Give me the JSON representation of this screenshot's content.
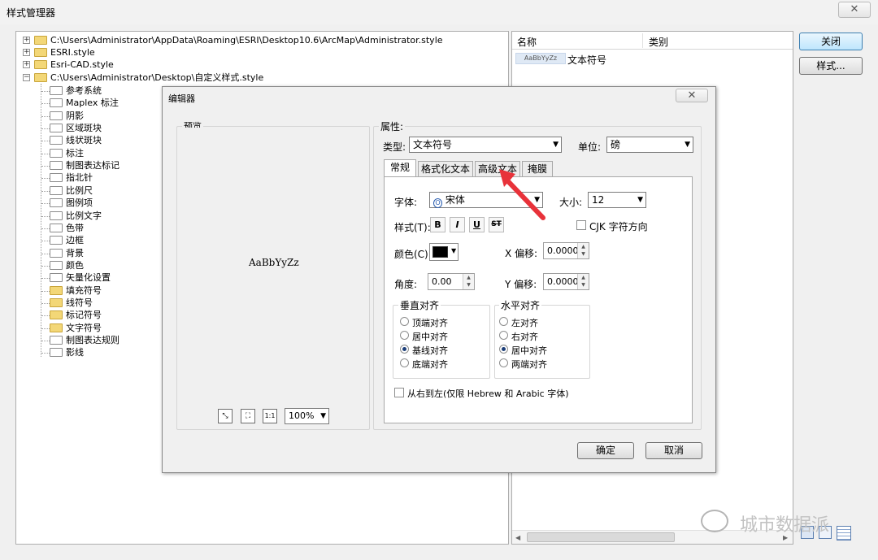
{
  "window": {
    "title": "样式管理器",
    "close_glyph": "✕"
  },
  "tree": {
    "roots": [
      {
        "label": "C:\\Users\\Administrator\\AppData\\Roaming\\ESRI\\Desktop10.6\\ArcMap\\Administrator.style",
        "expander": "+"
      },
      {
        "label": "ESRI.style",
        "expander": "+"
      },
      {
        "label": "Esri-CAD.style",
        "expander": "+"
      },
      {
        "label": "C:\\Users\\Administrator\\Desktop\\自定义样式.style",
        "expander": "−"
      }
    ],
    "children": [
      "参考系统",
      "Maplex 标注",
      "阴影",
      "区域斑块",
      "线状斑块",
      "标注",
      "制图表达标记",
      "指北针",
      "比例尺",
      "图例项",
      "比例文字",
      "色带",
      "边框",
      "背景",
      "颜色",
      "矢量化设置",
      "填充符号",
      "线符号",
      "标记符号",
      "文字符号",
      "制图表达规则",
      "影线"
    ]
  },
  "list": {
    "col_name": "名称",
    "col_category": "类别",
    "item_preview": "AaBbYyZz",
    "item_label": "文本符号"
  },
  "buttons": {
    "close": "关闭",
    "styles": "样式..."
  },
  "editor": {
    "title": "编辑器",
    "close_glyph": "✕",
    "preview_label": "预览",
    "preview_text": "AaBbYyZz",
    "zoom_value": "100%",
    "zoom_icons": [
      "⤡",
      "⛶",
      "1:1"
    ],
    "properties_label": "属性:",
    "type_label": "类型:",
    "type_value": "文本符号",
    "unit_label": "单位:",
    "unit_value": "磅",
    "tabs": [
      "常规",
      "格式化文本",
      "高级文本",
      "掩膜"
    ],
    "font_label": "字体:",
    "font_value": "宋体",
    "size_label": "大小:",
    "size_value": "12",
    "style_label": "样式(T):",
    "style_buttons": [
      "B",
      "I",
      "U",
      "ST"
    ],
    "cjk_label": "CJK 字符方向",
    "color_label": "颜色(C):",
    "color_value": "#000000",
    "x_offset_label": "X 偏移:",
    "x_offset_value": "0.0000",
    "angle_label": "角度:",
    "angle_value": "0.00",
    "y_offset_label": "Y 偏移:",
    "y_offset_value": "0.0000",
    "vertical_align": {
      "title": "垂直对齐",
      "options": [
        "顶端对齐",
        "居中对齐",
        "基线对齐",
        "底端对齐"
      ],
      "selected": 2
    },
    "horizontal_align": {
      "title": "水平对齐",
      "options": [
        "左对齐",
        "右对齐",
        "居中对齐",
        "两端对齐"
      ],
      "selected": 2
    },
    "rtl_label": "从右到左(仅限 Hebrew 和 Arabic 字体)",
    "ok": "确定",
    "cancel": "取消"
  },
  "watermark": "城市数据派",
  "accent_arrow_color": "#e8323a"
}
